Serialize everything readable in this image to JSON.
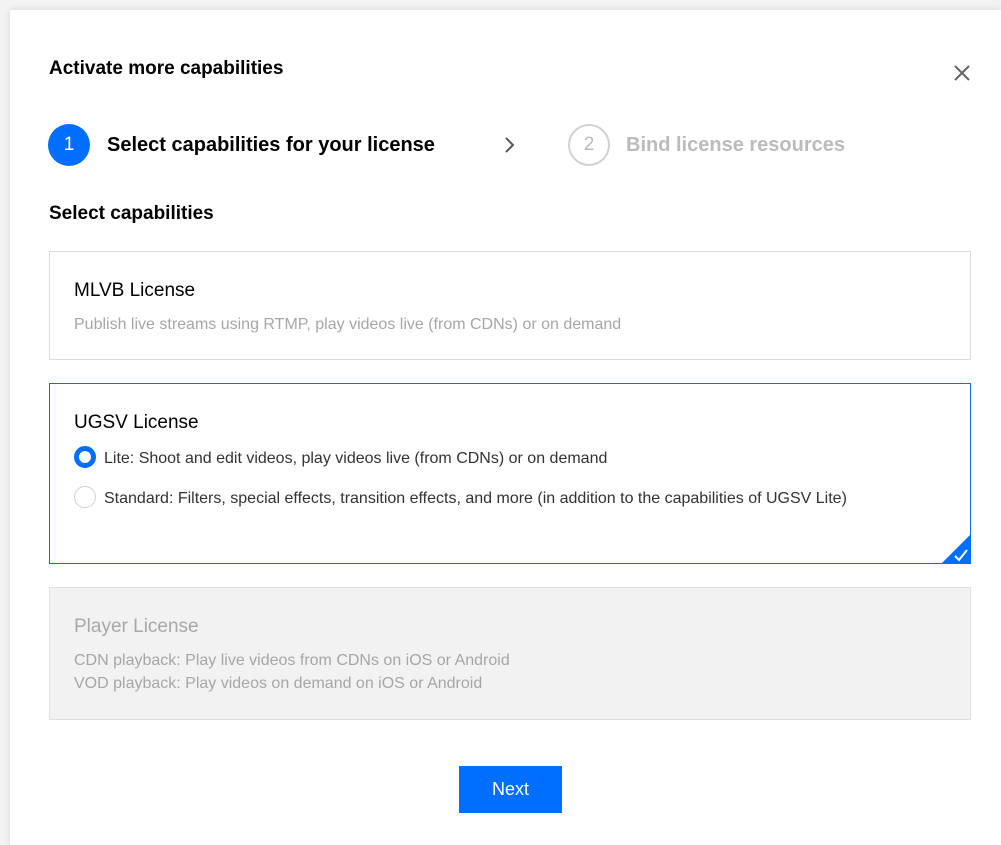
{
  "dialog": {
    "title": "Activate more capabilities",
    "close_icon": "close-icon"
  },
  "steps": [
    {
      "number": "1",
      "label": "Select capabilities for your license",
      "state": "active"
    },
    {
      "number": "2",
      "label": "Bind license resources",
      "state": "inactive"
    }
  ],
  "section": {
    "title": "Select capabilities"
  },
  "cards": {
    "mlvb": {
      "title": "MLVB License",
      "description": "Publish live streams using RTMP, play videos live (from CDNs) or on demand"
    },
    "ugsv": {
      "title": "UGSV License",
      "selected": true,
      "options": [
        {
          "label": "Lite: Shoot and edit videos, play videos live (from CDNs) or on demand",
          "checked": true
        },
        {
          "label": "Standard: Filters, special effects, transition effects, and more (in addition to the capabilities of UGSV Lite)",
          "checked": false
        }
      ]
    },
    "player": {
      "title": "Player License",
      "disabled": true,
      "description_lines": [
        "CDN playback: Play live videos from CDNs on iOS or Android",
        "VOD playback: Play videos on demand on iOS or Android"
      ]
    }
  },
  "footer": {
    "next_label": "Next"
  },
  "colors": {
    "accent": "#006eff",
    "disabled_text": "#bbbbbb",
    "muted_text": "#a6a6a6"
  }
}
